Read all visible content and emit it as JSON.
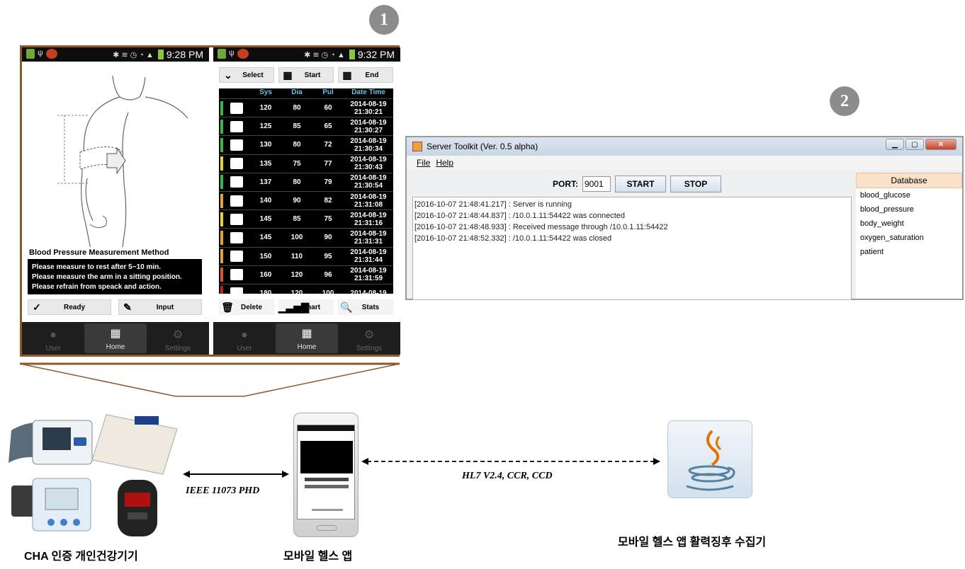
{
  "badges": {
    "one": "1",
    "two": "2"
  },
  "phone_left": {
    "status_time": "9:28 PM",
    "section_title": "Blood Pressure Measurement Method",
    "instructions": [
      "Please measure to rest after 5~10 min.",
      "Please measure the arm in a sitting position.",
      "Please refrain from speack and action."
    ],
    "ready_label": "Ready",
    "input_label": "Input"
  },
  "phone_right": {
    "status_time": "9:32 PM",
    "select_label": "Select",
    "start_label": "Start",
    "end_label": "End",
    "table_headers": {
      "sys": "Sys",
      "dia": "Dia",
      "pul": "Pul",
      "datetime": "Date Time"
    },
    "rows": [
      {
        "sys": "120",
        "dia": "80",
        "pul": "60",
        "date": "2014-08-19",
        "time": "21:30:21",
        "mark": "#3bb54a"
      },
      {
        "sys": "125",
        "dia": "85",
        "pul": "65",
        "date": "2014-08-19",
        "time": "21:30:27",
        "mark": "#3bb54a"
      },
      {
        "sys": "130",
        "dia": "80",
        "pul": "72",
        "date": "2014-08-19",
        "time": "21:30:34",
        "mark": "#3bb54a"
      },
      {
        "sys": "135",
        "dia": "75",
        "pul": "77",
        "date": "2014-08-19",
        "time": "21:30:43",
        "mark": "#e6d335"
      },
      {
        "sys": "137",
        "dia": "80",
        "pul": "79",
        "date": "2014-08-19",
        "time": "21:30:54",
        "mark": "#3bb54a"
      },
      {
        "sys": "140",
        "dia": "90",
        "pul": "82",
        "date": "2014-08-19",
        "time": "21:31:08",
        "mark": "#e6a335"
      },
      {
        "sys": "145",
        "dia": "85",
        "pul": "75",
        "date": "2014-08-19",
        "time": "21:31:16",
        "mark": "#e6d335"
      },
      {
        "sys": "145",
        "dia": "100",
        "pul": "90",
        "date": "2014-08-19",
        "time": "21:31:31",
        "mark": "#e6a335"
      },
      {
        "sys": "150",
        "dia": "110",
        "pul": "95",
        "date": "2014-08-19",
        "time": "21:31:44",
        "mark": "#e6a335"
      },
      {
        "sys": "160",
        "dia": "120",
        "pul": "96",
        "date": "2014-08-19",
        "time": "21:31:59",
        "mark": "#d9542b"
      },
      {
        "sys": "180",
        "dia": "120",
        "pul": "100",
        "date": "2014-08-19",
        "time": "",
        "mark": "#c01f1f"
      }
    ],
    "delete_label": "Delete",
    "chart_label": "Chart",
    "stats_label": "Stats"
  },
  "nav": {
    "user": "User",
    "home": "Home",
    "settings": "Settings"
  },
  "server": {
    "title": "Server Toolkit (Ver. 0.5 alpha)",
    "menu_file": "File",
    "menu_help": "Help",
    "port_label": "PORT:",
    "port_value": "9001",
    "start_label": "START",
    "stop_label": "STOP",
    "log": [
      "[2016-10-07 21:48:41.217] : Server is running",
      "[2016-10-07 21:48:44.837] : /10.0.1.11:54422 was connected",
      "[2016-10-07 21:48:48.933] : Received message through /10.0.1.11:54422",
      "[2016-10-07 21:48:52.332] : /10.0.1.11:54422 was closed"
    ],
    "db_header": "Database",
    "db_items": [
      "blood_glucose",
      "blood_pressure",
      "body_weight",
      "oxygen_saturation",
      "patient"
    ]
  },
  "bottom": {
    "devices_label": "CHA 인증 개인건강기기",
    "app_label": "모바일 헬스 앱",
    "collector_label": "모바일 헬스 앱 활력징후 수집기",
    "protocol1": "IEEE 11073 PHD",
    "protocol2": "HL7 V2.4, CCR, CCD"
  }
}
